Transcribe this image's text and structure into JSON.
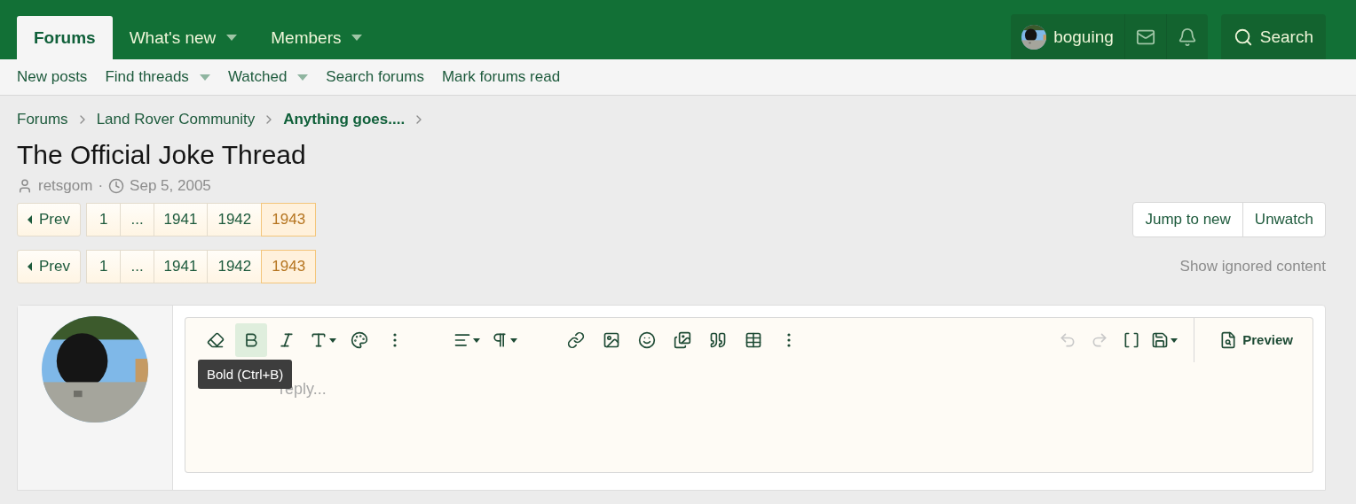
{
  "nav": {
    "tabs": [
      {
        "label": "Forums",
        "selected": true,
        "dropdown": false
      },
      {
        "label": "What's new",
        "selected": false,
        "dropdown": true
      },
      {
        "label": "Members",
        "selected": false,
        "dropdown": true
      }
    ],
    "user": "boguing",
    "search": "Search"
  },
  "subnav": [
    {
      "label": "New posts",
      "dropdown": false
    },
    {
      "label": "Find threads",
      "dropdown": true
    },
    {
      "label": "Watched",
      "dropdown": true
    },
    {
      "label": "Search forums",
      "dropdown": false
    },
    {
      "label": "Mark forums read",
      "dropdown": false
    }
  ],
  "breadcrumbs": [
    {
      "label": "Forums",
      "current": false
    },
    {
      "label": "Land Rover Community",
      "current": false
    },
    {
      "label": "Anything goes....",
      "current": true
    }
  ],
  "thread": {
    "title": "The Official Joke Thread",
    "author": "retsgom",
    "separator": "·",
    "date": "Sep 5, 2005"
  },
  "pagination": [
    {
      "prev": "Prev",
      "pages": [
        {
          "label": "1",
          "selected": false
        },
        {
          "label": "...",
          "selected": false
        },
        {
          "label": "1941",
          "selected": false
        },
        {
          "label": "1942",
          "selected": false
        },
        {
          "label": "1943",
          "selected": true
        }
      ]
    },
    {
      "prev": "Prev",
      "pages": [
        {
          "label": "1",
          "selected": false
        },
        {
          "label": "...",
          "selected": false
        },
        {
          "label": "1941",
          "selected": false
        },
        {
          "label": "1942",
          "selected": false
        },
        {
          "label": "1943",
          "selected": true
        }
      ]
    }
  ],
  "actions": [
    "Jump to new",
    "Unwatch"
  ],
  "ignored": "Show ignored content",
  "editor": {
    "toolbar": [
      {
        "highlighted": false,
        "dropdown": false
      },
      {
        "highlighted": true,
        "dropdown": false
      },
      {
        "highlighted": false,
        "dropdown": false
      },
      {
        "highlighted": false,
        "dropdown": true
      },
      {
        "highlighted": false,
        "dropdown": false
      },
      {
        "highlighted": false,
        "dropdown": false
      },
      {
        "highlighted": false,
        "dropdown": true
      },
      {
        "highlighted": false,
        "dropdown": true
      },
      {
        "highlighted": false,
        "dropdown": false
      },
      {
        "highlighted": false,
        "dropdown": false
      },
      {
        "highlighted": false,
        "dropdown": false
      },
      {
        "highlighted": false,
        "dropdown": false
      },
      {
        "highlighted": false,
        "dropdown": false
      },
      {
        "highlighted": false,
        "dropdown": false
      },
      {
        "highlighted": false,
        "dropdown": false
      }
    ],
    "right_tools": [
      {
        "disabled": true,
        "dropdown": false
      },
      {
        "disabled": true,
        "dropdown": false
      },
      {
        "disabled": false,
        "dropdown": false
      },
      {
        "disabled": false,
        "dropdown": true
      }
    ],
    "preview": "Preview",
    "tooltip": "Bold (Ctrl+B)",
    "placeholder": "reply..."
  }
}
